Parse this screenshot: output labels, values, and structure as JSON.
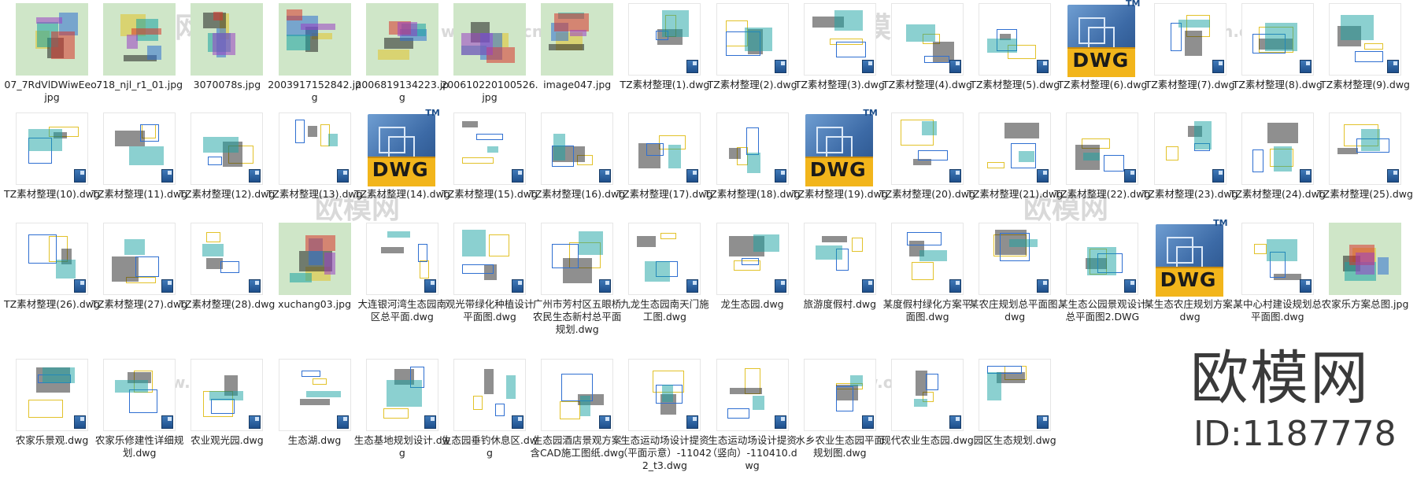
{
  "watermark": {
    "brand": "欧模网",
    "url": "www.om.cn"
  },
  "brand_overlay": {
    "logo": "欧模网",
    "id": "ID:1187778"
  },
  "files": [
    {
      "name": "07_7RdVlDWiwEeo.jpg",
      "kind": "image"
    },
    {
      "name": "718_njl_r1_01.jpg",
      "kind": "image"
    },
    {
      "name": "3070078s.jpg",
      "kind": "image"
    },
    {
      "name": "2003917152842.jpg",
      "kind": "image"
    },
    {
      "name": "2006819134223.jpg",
      "kind": "image"
    },
    {
      "name": "200610220100526.jpg",
      "kind": "image"
    },
    {
      "name": "image047.jpg",
      "kind": "image"
    },
    {
      "name": "TZ素材整理(1).dwg",
      "kind": "dwg-thumb"
    },
    {
      "name": "TZ素材整理(2).dwg",
      "kind": "dwg-thumb"
    },
    {
      "name": "TZ素材整理(3).dwg",
      "kind": "dwg-thumb"
    },
    {
      "name": "TZ素材整理(4).dwg",
      "kind": "dwg-thumb"
    },
    {
      "name": "TZ素材整理(5).dwg",
      "kind": "dwg-thumb"
    },
    {
      "name": "TZ素材整理(6).dwg",
      "kind": "dwg-icon"
    },
    {
      "name": "TZ素材整理(7).dwg",
      "kind": "dwg-thumb"
    },
    {
      "name": "TZ素材整理(8).dwg",
      "kind": "dwg-thumb"
    },
    {
      "name": "TZ素材整理(9).dwg",
      "kind": "dwg-thumb"
    },
    {
      "name": "TZ素材整理(10).dwg",
      "kind": "dwg-thumb"
    },
    {
      "name": "TZ素材整理(11).dwg",
      "kind": "dwg-thumb"
    },
    {
      "name": "TZ素材整理(12).dwg",
      "kind": "dwg-thumb"
    },
    {
      "name": "TZ素材整理(13).dwg",
      "kind": "dwg-thumb"
    },
    {
      "name": "TZ素材整理(14).dwg",
      "kind": "dwg-icon"
    },
    {
      "name": "TZ素材整理(15).dwg",
      "kind": "dwg-thumb"
    },
    {
      "name": "TZ素材整理(16).dwg",
      "kind": "dwg-thumb"
    },
    {
      "name": "TZ素材整理(17).dwg",
      "kind": "dwg-thumb"
    },
    {
      "name": "TZ素材整理(18).dwg",
      "kind": "dwg-thumb"
    },
    {
      "name": "TZ素材整理(19).dwg",
      "kind": "dwg-icon"
    },
    {
      "name": "TZ素材整理(20).dwg",
      "kind": "dwg-thumb"
    },
    {
      "name": "TZ素材整理(21).dwg",
      "kind": "dwg-thumb"
    },
    {
      "name": "TZ素材整理(22).dwg",
      "kind": "dwg-thumb"
    },
    {
      "name": "TZ素材整理(23).dwg",
      "kind": "dwg-thumb"
    },
    {
      "name": "TZ素材整理(24).dwg",
      "kind": "dwg-thumb"
    },
    {
      "name": "TZ素材整理(25).dwg",
      "kind": "dwg-thumb"
    },
    {
      "name": "TZ素材整理(26).dwg",
      "kind": "dwg-thumb"
    },
    {
      "name": "TZ素材整理(27).dwg",
      "kind": "dwg-thumb"
    },
    {
      "name": "TZ素材整理(28).dwg",
      "kind": "dwg-thumb"
    },
    {
      "name": "xuchang03.jpg",
      "kind": "image"
    },
    {
      "name": "大连银河湾生态园南区总平面.dwg",
      "kind": "dwg-thumb"
    },
    {
      "name": "观光带绿化种植设计平面图.dwg",
      "kind": "dwg-thumb"
    },
    {
      "name": "广州市芳村区五眼桥农民生态新村总平面规划.dwg",
      "kind": "dwg-thumb"
    },
    {
      "name": "九龙生态园南天门施工图.dwg",
      "kind": "dwg-thumb"
    },
    {
      "name": "龙生态园.dwg",
      "kind": "dwg-thumb"
    },
    {
      "name": "旅游度假村.dwg",
      "kind": "dwg-thumb"
    },
    {
      "name": "某度假村绿化方案平面图.dwg",
      "kind": "dwg-thumb"
    },
    {
      "name": "某农庄规划总平面图.dwg",
      "kind": "dwg-thumb"
    },
    {
      "name": "某生态公园景观设计总平面图2.DWG",
      "kind": "dwg-thumb"
    },
    {
      "name": "某生态农庄规划方案.dwg",
      "kind": "dwg-icon"
    },
    {
      "name": "某中心村建设规划总平面图.dwg",
      "kind": "dwg-thumb"
    },
    {
      "name": "农家乐方案总图.jpg",
      "kind": "image"
    },
    {
      "name": "农家乐景观.dwg",
      "kind": "dwg-thumb"
    },
    {
      "name": "农家乐修建性详细规划.dwg",
      "kind": "dwg-thumb"
    },
    {
      "name": "农业观光园.dwg",
      "kind": "dwg-thumb"
    },
    {
      "name": "生态湖.dwg",
      "kind": "dwg-thumb"
    },
    {
      "name": "生态基地规划设计.dwg",
      "kind": "dwg-thumb"
    },
    {
      "name": "生态园垂钓休息区.dwg",
      "kind": "dwg-thumb"
    },
    {
      "name": "生态园酒店景观方案含CAD施工图纸.dwg",
      "kind": "dwg-thumb"
    },
    {
      "name": "生态运动场设计提资（平面示意）-110422_t3.dwg",
      "kind": "dwg-thumb"
    },
    {
      "name": "生态运动场设计提资（竖向）-110410.dwg",
      "kind": "dwg-thumb"
    },
    {
      "name": "水乡农业生态园平面规划图.dwg",
      "kind": "dwg-thumb"
    },
    {
      "name": "现代农业生态园.dwg",
      "kind": "dwg-thumb"
    },
    {
      "name": "园区生态规划.dwg",
      "kind": "dwg-thumb"
    }
  ],
  "dwg_icon": {
    "label": "DWG",
    "tm": "TM"
  },
  "colors": {
    "dwg_band": "#f2b51b",
    "dwg_blue": "#3c6aa6",
    "badge": "#2a5c98"
  }
}
